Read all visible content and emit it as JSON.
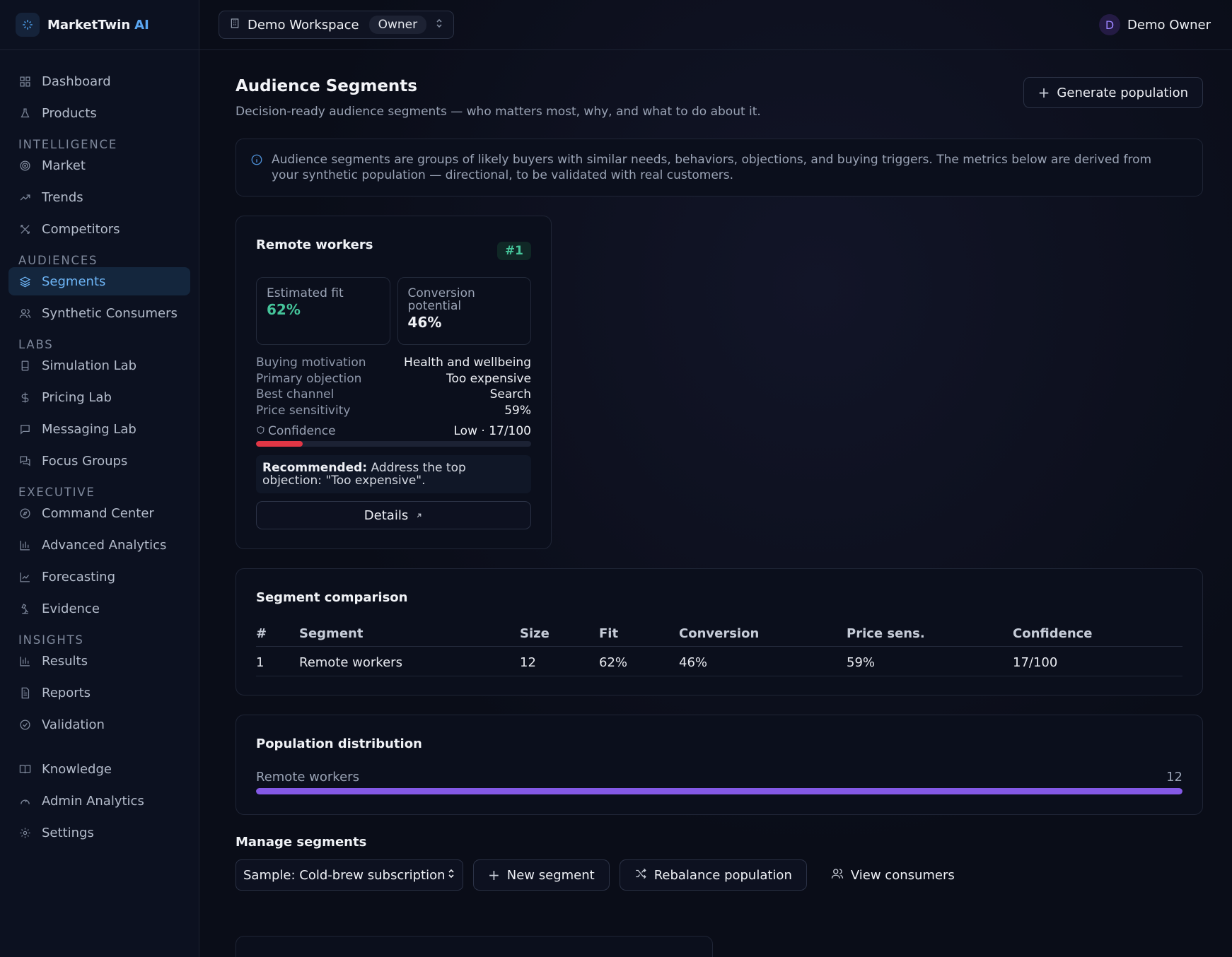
{
  "brand": {
    "name": "MarketTwin",
    "accent": "AI"
  },
  "workspace": {
    "name": "Demo Workspace",
    "role": "Owner"
  },
  "user": {
    "initial": "D",
    "name": "Demo Owner"
  },
  "sidebar": {
    "top_items": [
      {
        "label": "Dashboard",
        "icon": "grid-icon"
      },
      {
        "label": "Products",
        "icon": "flask-icon"
      }
    ],
    "sections": [
      {
        "title": "INTELLIGENCE",
        "items": [
          {
            "label": "Market",
            "icon": "radar-icon"
          },
          {
            "label": "Trends",
            "icon": "trend-up-icon"
          },
          {
            "label": "Competitors",
            "icon": "swords-icon"
          }
        ]
      },
      {
        "title": "AUDIENCES",
        "items": [
          {
            "label": "Segments",
            "icon": "layers-icon",
            "active": true
          },
          {
            "label": "Synthetic Consumers",
            "icon": "users-icon"
          }
        ]
      },
      {
        "title": "LABS",
        "items": [
          {
            "label": "Simulation Lab",
            "icon": "flask-icon"
          },
          {
            "label": "Pricing Lab",
            "icon": "dollar-icon"
          },
          {
            "label": "Messaging Lab",
            "icon": "message-icon"
          },
          {
            "label": "Focus Groups",
            "icon": "chat-icon"
          }
        ]
      },
      {
        "title": "EXECUTIVE",
        "items": [
          {
            "label": "Command Center",
            "icon": "compass-icon"
          },
          {
            "label": "Advanced Analytics",
            "icon": "bar-chart-icon"
          },
          {
            "label": "Forecasting",
            "icon": "line-chart-icon"
          },
          {
            "label": "Evidence",
            "icon": "microscope-icon"
          }
        ]
      },
      {
        "title": "INSIGHTS",
        "items": [
          {
            "label": "Results",
            "icon": "bar-chart-icon"
          },
          {
            "label": "Reports",
            "icon": "file-icon"
          },
          {
            "label": "Validation",
            "icon": "check-circle-icon"
          }
        ]
      }
    ],
    "bottom_items": [
      {
        "label": "Knowledge",
        "icon": "book-icon"
      },
      {
        "label": "Admin Analytics",
        "icon": "gauge-icon"
      },
      {
        "label": "Settings",
        "icon": "gear-icon"
      }
    ]
  },
  "page": {
    "title": "Audience Segments",
    "subtitle": "Decision-ready audience segments — who matters most, why, and what to do about it.",
    "generate_label": "Generate population",
    "info": "Audience segments are groups of likely buyers with similar needs, behaviors, objections, and buying triggers. The metrics below are derived from your synthetic population — directional, to be validated with real customers."
  },
  "segment_card": {
    "name": "Remote workers",
    "rank": "#1",
    "fit_label": "Estimated fit",
    "fit_value": "62%",
    "conversion_label": "Conversion potential",
    "conversion_value": "46%",
    "rows": [
      {
        "k": "Buying motivation",
        "v": "Health and wellbeing"
      },
      {
        "k": "Primary objection",
        "v": "Too expensive"
      },
      {
        "k": "Best channel",
        "v": "Search"
      },
      {
        "k": "Price sensitivity",
        "v": "59%"
      }
    ],
    "confidence_label": "Confidence",
    "confidence_value": "Low · 17/100",
    "confidence_score": 17,
    "recommended_label": "Recommended:",
    "recommended_text": "Address the top objection: \"Too expensive\".",
    "details_label": "Details"
  },
  "comparison": {
    "title": "Segment comparison",
    "columns": [
      "#",
      "Segment",
      "Size",
      "Fit",
      "Conversion",
      "Price sens.",
      "Confidence"
    ],
    "rows": [
      [
        "1",
        "Remote workers",
        "12",
        "62%",
        "46%",
        "59%",
        "17/100"
      ]
    ]
  },
  "distribution": {
    "title": "Population distribution",
    "rows": [
      {
        "label": "Remote workers",
        "value": "12",
        "fraction": 1.0
      }
    ]
  },
  "manage": {
    "title": "Manage segments",
    "select_value": "Sample: Cold-brew subscription",
    "new_label": "New segment",
    "rebalance_label": "Rebalance population",
    "view_label": "View consumers"
  },
  "colors": {
    "accent": "#5aa7f2",
    "fit_green": "#45c49a",
    "confidence_red": "#e03645",
    "distribution_purple": "#8459e6"
  }
}
